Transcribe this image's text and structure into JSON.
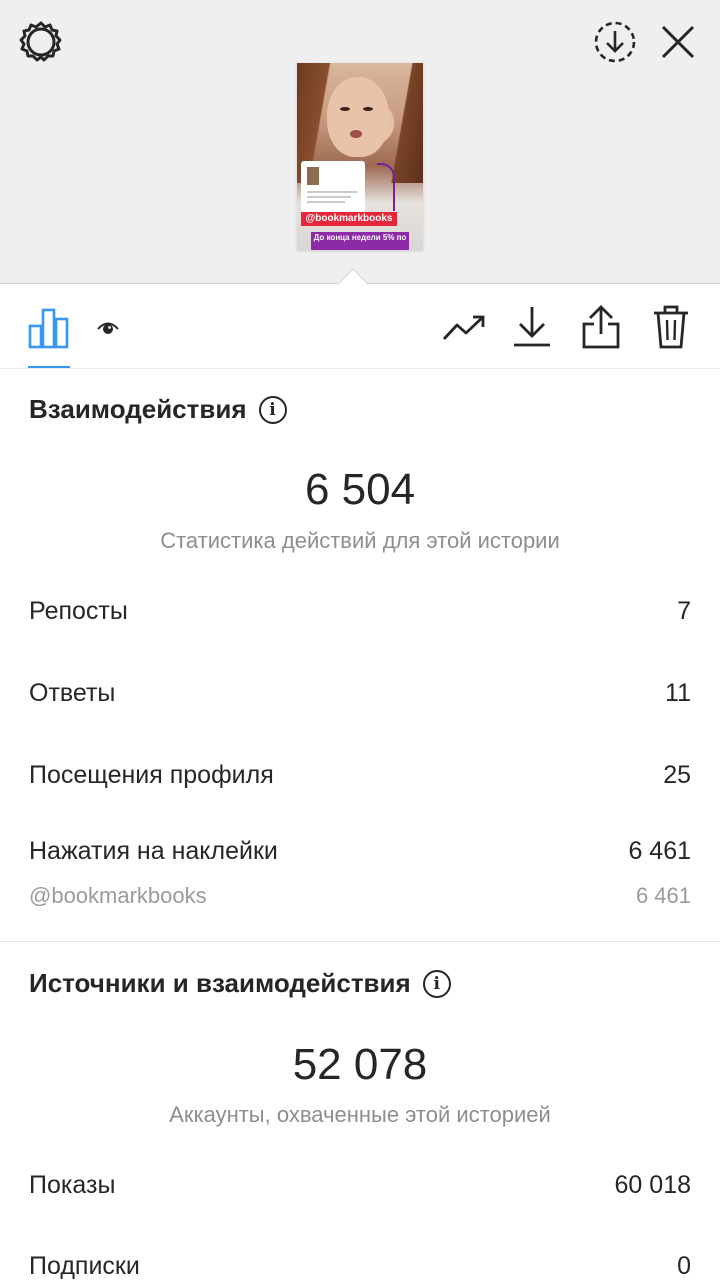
{
  "header": {
    "icons": [
      "gear-icon",
      "save-icon",
      "close-icon"
    ]
  },
  "story_preview": {
    "sticker_tag": "@bookmarkbooks",
    "banner_text": "До конца недели 5% по"
  },
  "tabs": {
    "active": "stats",
    "left": [
      "stats-icon",
      "eye-icon"
    ],
    "right": [
      "insights-icon",
      "download-icon",
      "share-icon",
      "trash-icon"
    ]
  },
  "interactions": {
    "title": "Взаимодействия",
    "total": "6 504",
    "caption": "Статистика действий для этой истории",
    "rows": [
      {
        "label": "Репосты",
        "value": "7"
      },
      {
        "label": "Ответы",
        "value": "11"
      },
      {
        "label": "Посещения профиля",
        "value": "25"
      },
      {
        "label": "Нажатия на наклейки",
        "value": "6 461"
      }
    ],
    "sticker_row": {
      "label": "@bookmarkbooks",
      "value": "6 461"
    }
  },
  "discovery": {
    "title": "Источники и взаимодействия",
    "total": "52 078",
    "caption": "Аккаунты, охваченные этой историей",
    "rows": [
      {
        "label": "Показы",
        "value": "60 018"
      },
      {
        "label": "Подписки",
        "value": "0"
      }
    ]
  },
  "colors": {
    "accent": "#3897f0",
    "text": "#262626",
    "secondary": "#8e8e8e",
    "preview_bg": "#efefef"
  }
}
